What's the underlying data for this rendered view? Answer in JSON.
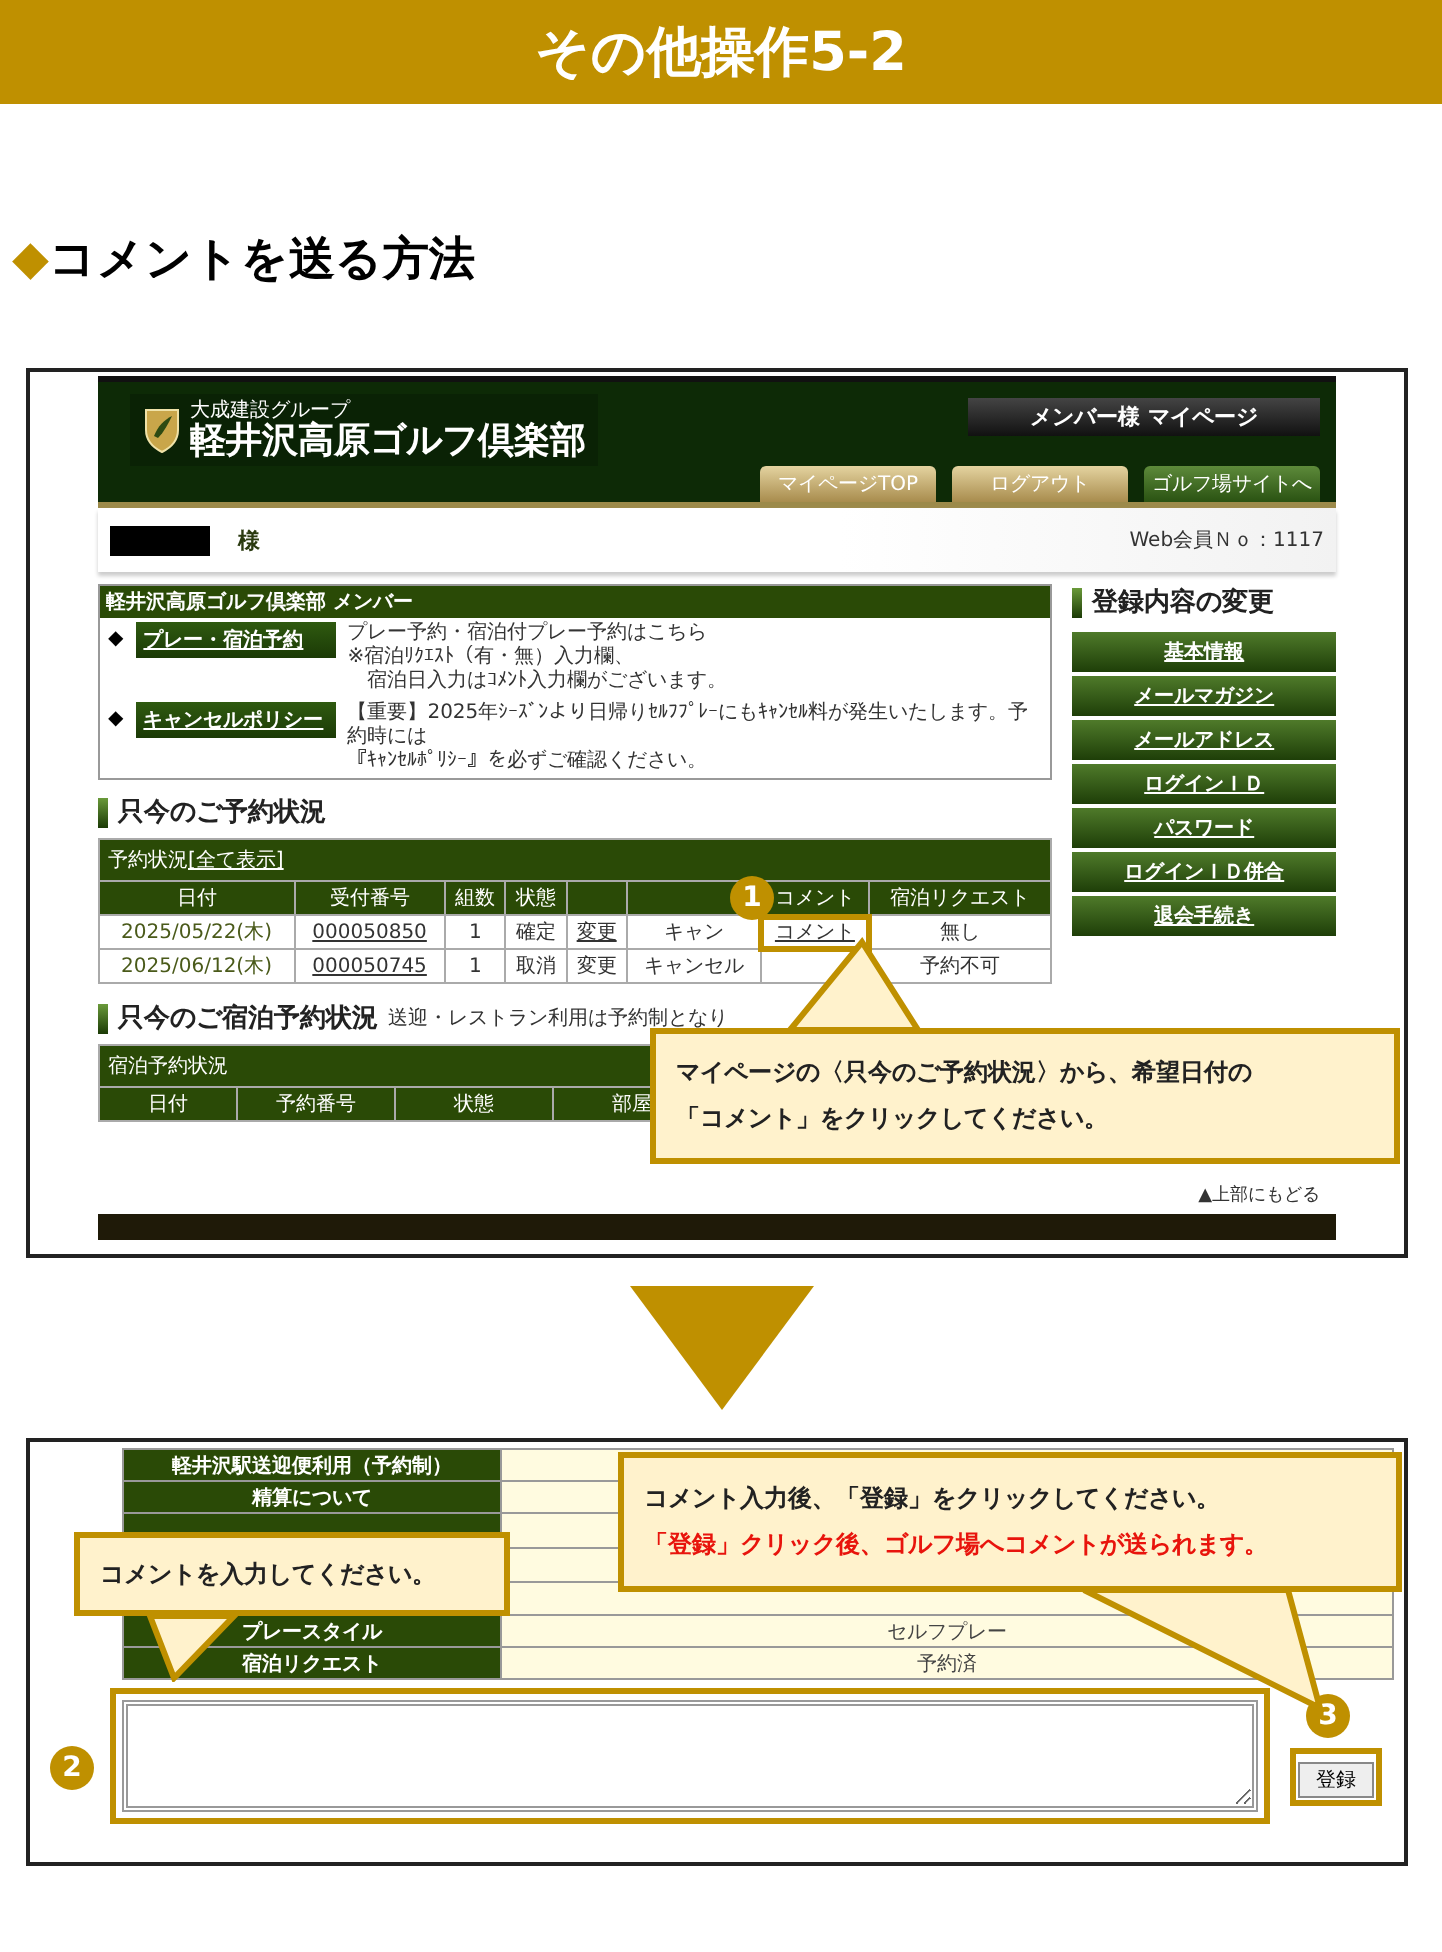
{
  "slide": {
    "title": "その他操作5-2"
  },
  "heading": {
    "marker": "◆",
    "text": "コメントを送る方法"
  },
  "screenshot_1": {
    "site_header": {
      "group": "大成建設グループ",
      "club": "軽井沢高原ゴルフ倶楽部",
      "page_title": "メンバー様 マイページ",
      "nav": [
        {
          "label": "マイページTOP",
          "kind": "gold"
        },
        {
          "label": "ログアウト",
          "kind": "gold"
        },
        {
          "label": "ゴルフ場サイトへ",
          "kind": "green"
        }
      ]
    },
    "member_bar": {
      "honorific": "様",
      "member_no": "Web会員Ｎｏ：1117"
    },
    "member_box": {
      "title": "軽井沢高原ゴルフ倶楽部 メンバー",
      "items": [
        {
          "marker": "◆",
          "label": "プレー・宿泊予約",
          "lines": [
            "プレー予約・宿泊付プレー予約はこちら",
            "※宿泊ﾘｸｴｽﾄ（有・無）入力欄、",
            "　宿泊日入力はｺﾒﾝﾄ入力欄がございます。"
          ]
        },
        {
          "marker": "◆",
          "label": "キャンセルポリシー",
          "lines": [
            "【重要】2025年ｼｰｽﾞﾝより日帰りｾﾙﾌﾌﾟﾚｰにもｷｬﾝｾﾙ料が発生いたします。予約時には",
            "『ｷｬﾝｾﾙﾎﾟﾘｼｰ』を必ずご確認ください。"
          ]
        }
      ]
    },
    "reservations": {
      "title": "只今のご予約状況",
      "caption": "予約状況",
      "caption_link": "[全て表示]",
      "columns": [
        {
          "label": "日付"
        },
        {
          "label": "受付番号"
        },
        {
          "label": "組数"
        },
        {
          "label": "状態"
        },
        {},
        {},
        {
          "label": "コメント"
        },
        {
          "label": "宿泊リクエスト"
        }
      ],
      "rows": [
        {
          "cells": [
            {
              "text": "2025/05/22(木)",
              "kind": "date"
            },
            {
              "text": "000050850",
              "link": true
            },
            {
              "text": "1"
            },
            {
              "text": "確定"
            },
            {
              "text": "変更",
              "link": true
            },
            {
              "text": "キャン"
            },
            {
              "text": "コメント",
              "link": true,
              "highlighted": true
            },
            {
              "text": "無し"
            }
          ]
        },
        {
          "cells": [
            {
              "text": "2025/06/12(木)",
              "kind": "date"
            },
            {
              "text": "000050745",
              "link": true
            },
            {
              "text": "1"
            },
            {
              "text": "取消"
            },
            {
              "text": "変更"
            },
            {
              "text": "キャンセル"
            },
            {
              "kind": "covered"
            },
            {
              "text": "予約不可"
            }
          ]
        }
      ]
    },
    "stay_reservations": {
      "title": "只今のご宿泊予約状況",
      "note": "送迎・レストラン利用は予約制となり",
      "caption": "宿泊予約状況",
      "columns": [
        "日付",
        "予約番号",
        "状態",
        "部屋"
      ]
    },
    "back_to_top": "▲上部にもどる",
    "side_menu": {
      "title": "登録内容の変更",
      "items": [
        "基本情報",
        "メールマガジン",
        "メールアドレス",
        "ログインＩＤ",
        "パスワード",
        "ログインＩＤ併合",
        "退会手続き"
      ]
    },
    "callout": {
      "step": "1",
      "lines": [
        "マイページの〈只今のご予約状況〉から、希望日付の",
        "「コメント」をクリックしてください。"
      ]
    }
  },
  "screenshot_2": {
    "rows": [
      {
        "label": "軽井沢駅送迎便利用（予約制）"
      },
      {
        "label": "精算について"
      },
      {
        "kind": "covered"
      },
      {
        "label": "プレースタイル",
        "value": "セルフプレー"
      },
      {
        "label": "宿泊リクエスト",
        "value": "予約済"
      }
    ],
    "comment_box": {
      "step": "2"
    },
    "submit": {
      "step": "3",
      "label": "登録"
    },
    "callouts": [
      {
        "lines": [
          {
            "text": "コメントを入力してください。",
            "kind": "note"
          }
        ]
      },
      {
        "lines": [
          {
            "text": "コメント入力後、「登録」をクリックしてください。",
            "kind": "note"
          },
          {
            "text": "「登録」クリック後、ゴルフ場へコメントが送られます。",
            "kind": "alert"
          }
        ]
      }
    ]
  }
}
